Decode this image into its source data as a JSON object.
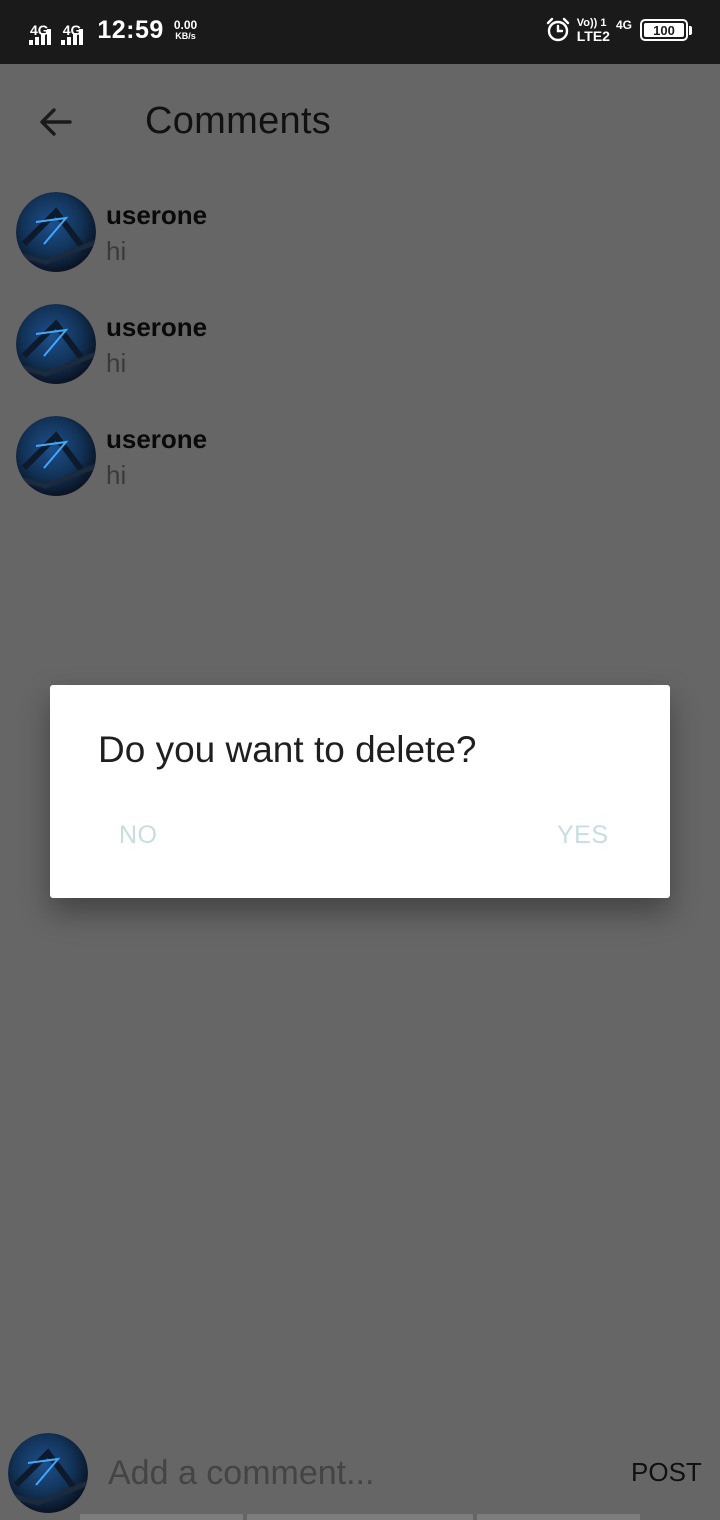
{
  "status_bar": {
    "sim1_label": "4G",
    "sim2_label": "4G",
    "time": "12:59",
    "speed_value": "0.00",
    "speed_unit": "KB/s",
    "volte_top": "Vo)) 1",
    "volte_bottom": "LTE2",
    "network_right": "4G",
    "battery": "100",
    "icons": [
      "signal-icon",
      "alarm-icon",
      "battery-icon"
    ]
  },
  "header": {
    "back_icon": "arrow-back-icon",
    "title": "Comments"
  },
  "comments": [
    {
      "username": "userone",
      "text": "hi"
    },
    {
      "username": "userone",
      "text": "hi"
    },
    {
      "username": "userone",
      "text": "hi"
    }
  ],
  "dialog": {
    "message": "Do you want to delete?",
    "negative_label": "NO",
    "positive_label": "YES"
  },
  "composer": {
    "placeholder": "Add a comment...",
    "post_label": "POST"
  },
  "colors": {
    "scrim": "#666666",
    "status_bar": "#1a1a1a",
    "dialog_button_text": "#c8dde0"
  }
}
